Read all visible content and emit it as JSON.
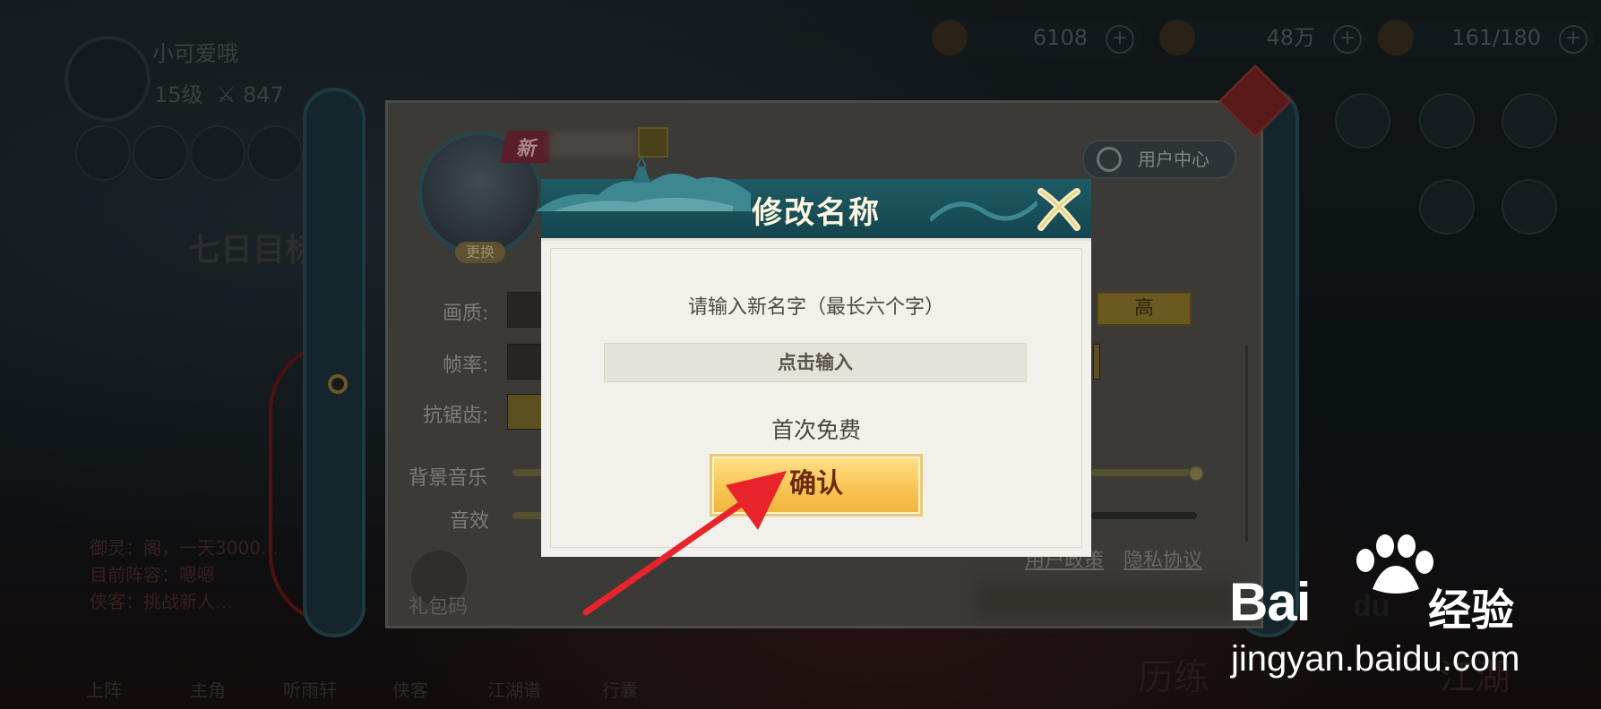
{
  "hud": {
    "player_name": "小可爱哦",
    "player_level": "15级",
    "power": "847",
    "resources": [
      {
        "icon": "ticket-icon",
        "value": "6108"
      },
      {
        "icon": "coin-icon",
        "value": "48万"
      },
      {
        "icon": "stamina-icon",
        "value": "161/180"
      }
    ]
  },
  "background": {
    "bottom_nav": [
      "上阵",
      "主角",
      "听雨轩",
      "侠客",
      "江湖谱",
      "行囊"
    ],
    "right_labels": [
      "历练",
      "江湖"
    ],
    "event_title": "七日目标",
    "red_notices": [
      "御灵：阁，一天3000…",
      "目前阵容：嗯嗯",
      "侠客：挑战新人…"
    ]
  },
  "settings": {
    "new_tag": "新",
    "change_avatar_label": "更换",
    "user_center_label": "用户中心",
    "rows": [
      {
        "label": "画质:"
      },
      {
        "label": "帧率:"
      },
      {
        "label": "抗锯齿:"
      },
      {
        "label": "背景音乐"
      },
      {
        "label": "音效"
      }
    ],
    "quality_high_label": "高",
    "user_policy_label": "用户政策",
    "privacy_label": "隐私协议",
    "gift_code_label": "礼包码"
  },
  "modal": {
    "title": "修改名称",
    "prompt": "请输入新名字（最长六个字）",
    "input_placeholder": "点击输入",
    "cost_note": "首次免费",
    "confirm_label": "确认"
  },
  "watermark": {
    "logo_text": "Bai",
    "logo_du": "du",
    "logo_cn": "经验",
    "url": "jingyan.baidu.com"
  },
  "colors": {
    "modal_header": "#1f5b64",
    "confirm_button": "#f8c553",
    "confirm_text": "#6b2a10",
    "annotation_arrow": "#e8232b"
  }
}
